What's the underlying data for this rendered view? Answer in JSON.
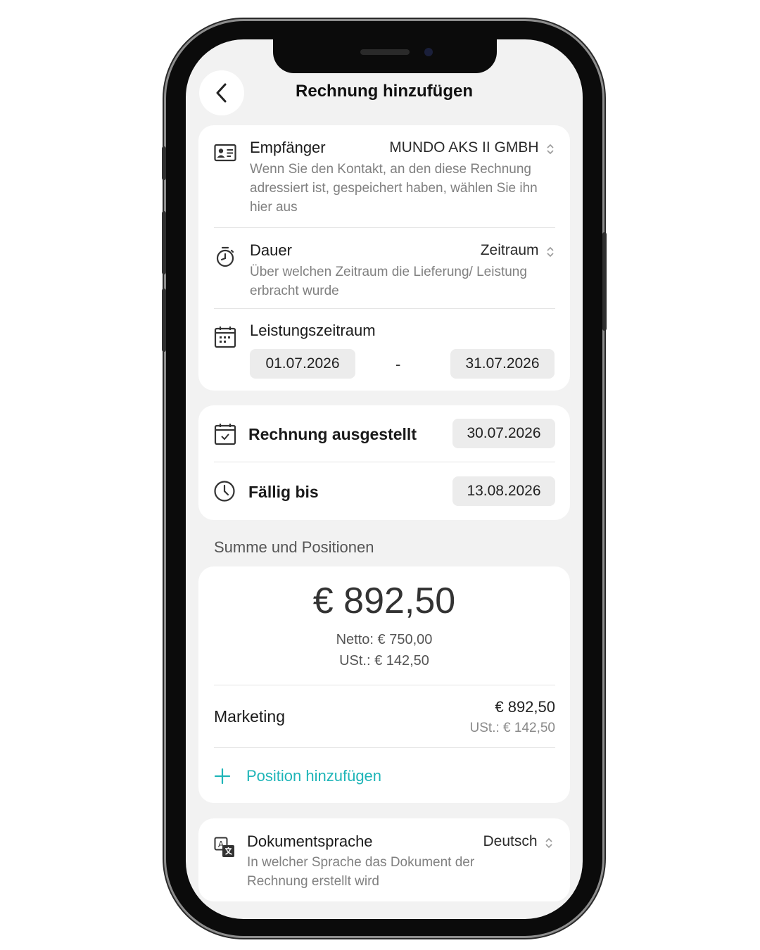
{
  "header": {
    "title": "Rechnung hinzufügen"
  },
  "recipient": {
    "label": "Empfänger",
    "value": "MUNDO AKS II GMBH",
    "description": "Wenn Sie den Kontakt, an den diese Rechnung adressiert ist, gespeichert haben, wählen Sie ihn hier aus"
  },
  "duration": {
    "label": "Dauer",
    "value": "Zeitraum",
    "description": "Über welchen Zeitraum die Lieferung/ Leistung erbracht wurde"
  },
  "service_period": {
    "label": "Leistungszeitraum",
    "start": "01.07.2026",
    "separator": "-",
    "end": "31.07.2026"
  },
  "issued": {
    "label": "Rechnung ausgestellt",
    "date": "30.07.2026"
  },
  "due": {
    "label": "Fällig bis",
    "date": "13.08.2026"
  },
  "totals": {
    "section_title": "Summe und Positionen",
    "total": "€ 892,50",
    "net": "Netto: € 750,00",
    "vat": "USt.: € 142,50"
  },
  "positions": [
    {
      "name": "Marketing",
      "amount": "€ 892,50",
      "vat": "USt.: € 142,50"
    }
  ],
  "add_position_label": "Position hinzufügen",
  "language": {
    "label": "Dokumentsprache",
    "value": "Deutsch",
    "description": "In welcher Sprache das Dokument der Rechnung erstellt wird"
  },
  "colors": {
    "accent": "#1fb5b8",
    "background": "#f2f2f2",
    "card": "#ffffff"
  },
  "icons": [
    "back-arrow-icon",
    "contact-card-icon",
    "stopwatch-icon",
    "calendar-grid-icon",
    "calendar-check-icon",
    "clock-icon",
    "plus-icon",
    "translate-icon",
    "chevron-updown-icon"
  ]
}
